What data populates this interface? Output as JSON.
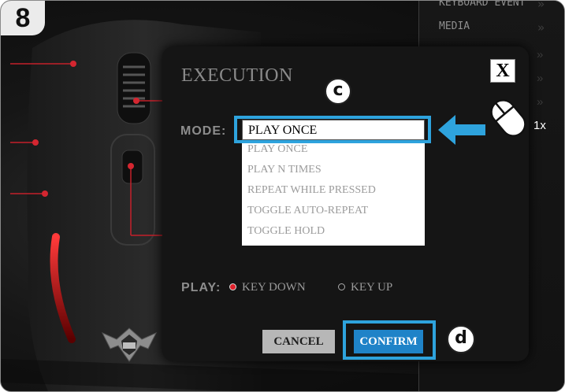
{
  "step_number": "8",
  "background_menu": {
    "items": [
      {
        "label": "KEYBOARD EVENT",
        "chevron": "»"
      },
      {
        "label": "MEDIA",
        "chevron": "»"
      }
    ],
    "extra_chevron": "»"
  },
  "dialog": {
    "title": "EXECUTION",
    "close_label": "X",
    "mode_label": "MODE:",
    "mode_selected": "PLAY ONCE",
    "mode_options": [
      "PLAY ONCE",
      "PLAY N TIMES",
      "REPEAT WHILE PRESSED",
      "TOGGLE AUTO-REPEAT",
      "TOGGLE HOLD"
    ],
    "play_label": "PLAY:",
    "play_options": [
      {
        "label": "KEY DOWN",
        "selected": true
      },
      {
        "label": "KEY UP",
        "selected": false
      }
    ],
    "cancel_label": "CANCEL",
    "confirm_label": "CONFIRM"
  },
  "callouts": {
    "c": "c",
    "d": "d",
    "click_count": "1x"
  },
  "icons": [
    "mouse-click-icon",
    "arrow-left-icon",
    "close-icon",
    "gxt-logo-icon"
  ],
  "colors": {
    "accent": "#2ea3dd",
    "confirm": "#1f83c8",
    "led_red": "#e0202a",
    "background": "#141414"
  }
}
